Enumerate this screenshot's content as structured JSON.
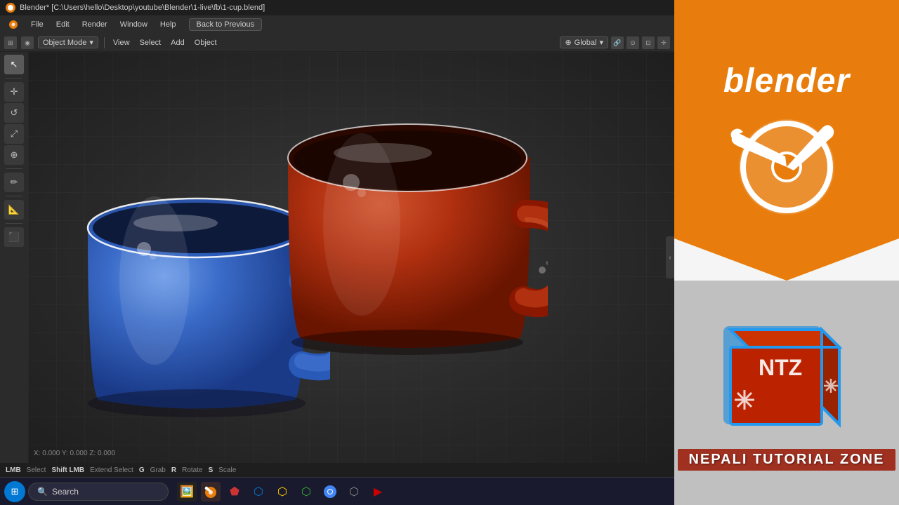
{
  "titlebar": {
    "title": "Blender* [C:\\Users\\hello\\Desktop\\youtube\\Blender\\1-live\\fb\\1-cup.blend]"
  },
  "menubar": {
    "items": [
      "Blender",
      "File",
      "Edit",
      "Render",
      "Window",
      "Help"
    ],
    "back_btn": "Back to Previous"
  },
  "toolbar": {
    "mode": "Object Mode",
    "view_label": "View",
    "select_label": "Select",
    "add_label": "Add",
    "object_label": "Object",
    "global_label": "Global"
  },
  "tools": [
    {
      "name": "select-tool",
      "icon": "↖",
      "active": true
    },
    {
      "name": "move-tool",
      "icon": "✛",
      "active": false
    },
    {
      "name": "rotate-tool",
      "icon": "↺",
      "active": false
    },
    {
      "name": "scale-tool",
      "icon": "⤢",
      "active": false
    },
    {
      "name": "transform-tool",
      "icon": "⊞",
      "active": false
    },
    {
      "name": "annotate-tool",
      "icon": "✏",
      "active": false
    },
    {
      "name": "measure-tool",
      "icon": "📐",
      "active": false
    },
    {
      "name": "add-cube-tool",
      "icon": "⬛",
      "active": false
    }
  ],
  "blender_logo": {
    "text": "blender",
    "brand_color": "#e87d0d"
  },
  "ntz": {
    "label": "NEPALI TUTORIAL ZONE",
    "cube_front_color": "#cc2200",
    "cube_side_color": "#aa1500",
    "cube_top_color": "#dd3300",
    "border_color": "#2299ee",
    "text": "NTZ"
  },
  "taskbar": {
    "search_placeholder": "Search",
    "start_icon": "⊞",
    "apps": [
      {
        "name": "file-explorer-icon",
        "color": "#f0a030",
        "icon": "📁"
      },
      {
        "name": "blender-app-icon",
        "color": "#e87d0d",
        "icon": "🔷"
      },
      {
        "name": "app2-icon",
        "color": "#cc3333",
        "icon": "🔴"
      },
      {
        "name": "vscode-icon",
        "color": "#007acc",
        "icon": "🔵"
      },
      {
        "name": "app4-icon",
        "color": "#ffcc00",
        "icon": "🟡"
      },
      {
        "name": "app5-icon",
        "color": "#33cc33",
        "icon": "🟢"
      },
      {
        "name": "chrome-icon",
        "color": "#4285f4",
        "icon": "🌐"
      },
      {
        "name": "app7-icon",
        "color": "#888",
        "icon": "⚙"
      },
      {
        "name": "app8-icon",
        "color": "#c00",
        "icon": "▶"
      }
    ]
  },
  "viewport": {
    "blue_mug_color": "#3a6bc8",
    "red_mug_color": "#b03010",
    "background_color": "#303030"
  }
}
